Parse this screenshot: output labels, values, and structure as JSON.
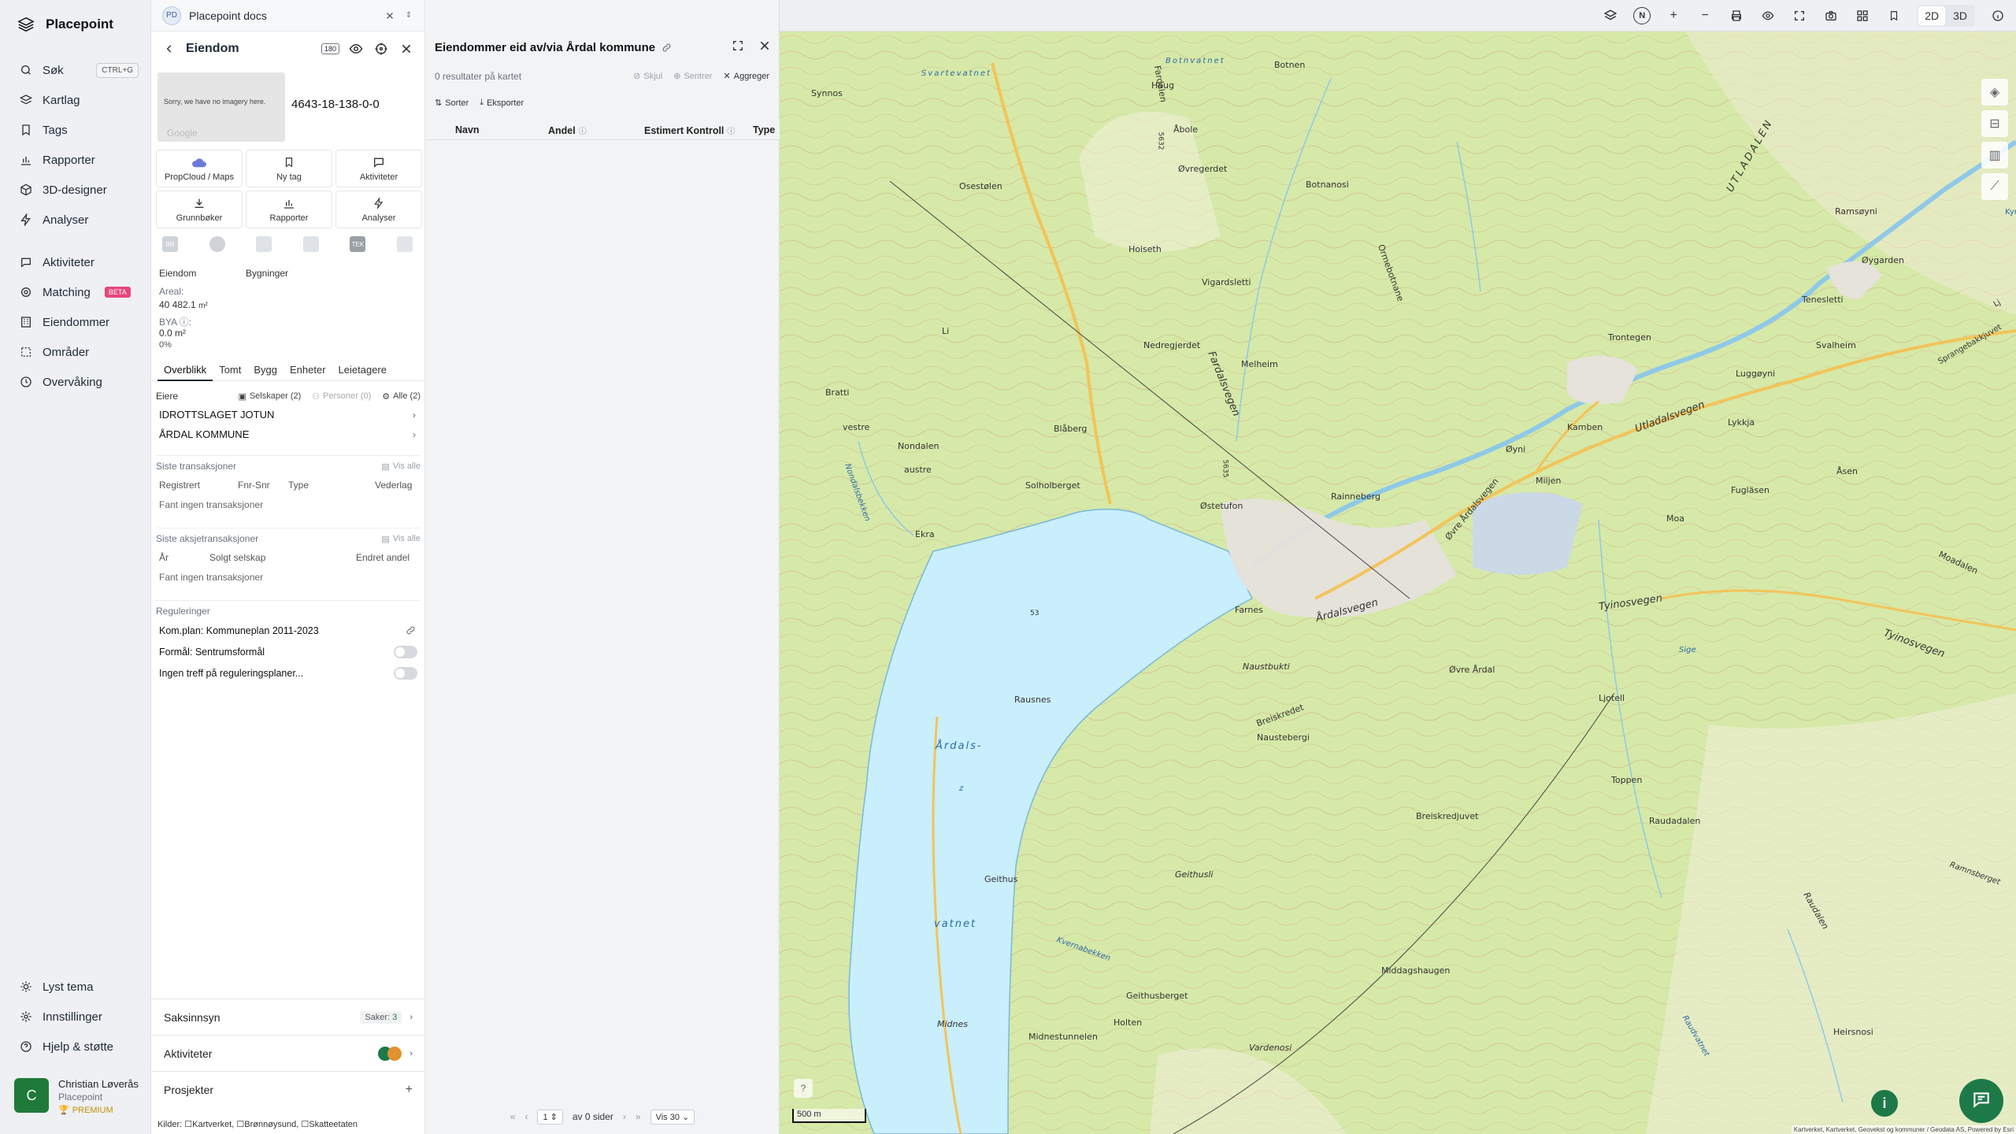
{
  "app": {
    "name": "Placepoint"
  },
  "nav": {
    "items": [
      {
        "label": "Søk",
        "shortcut": "CTRL+G"
      },
      {
        "label": "Kartlag"
      },
      {
        "label": "Tags"
      },
      {
        "label": "Rapporter"
      },
      {
        "label": "3D-designer"
      },
      {
        "label": "Analyser"
      }
    ],
    "items2": [
      {
        "label": "Aktiviteter"
      },
      {
        "label": "Matching",
        "badge": "BETA"
      },
      {
        "label": "Eiendommer"
      },
      {
        "label": "Områder"
      },
      {
        "label": "Overvåking"
      }
    ],
    "bottom": [
      {
        "label": "Lyst tema"
      },
      {
        "label": "Innstillinger"
      },
      {
        "label": "Hjelp & støtte"
      }
    ],
    "user": {
      "initial": "C",
      "name": "Christian Løverås",
      "org": "Placepoint",
      "plan": "PREMIUM"
    }
  },
  "docs": {
    "badge": "PD",
    "title": "Placepoint docs"
  },
  "property": {
    "header": "Eiendom",
    "tag_box": "180",
    "image_note": "Sorry, we have no imagery here.",
    "image_google": "Google",
    "id": "4643-18-138-0-0",
    "actions": [
      "PropCloud / Maps",
      "Ny tag",
      "Aktiviteter",
      "Grunnbøker",
      "Rapporter",
      "Analyser"
    ],
    "strip": [
      "BR",
      "",
      "",
      "",
      "TEK",
      ""
    ],
    "summary": {
      "col1_label": "Eiendom",
      "col2_label": "Bygninger",
      "areal_label": "Areal:",
      "areal_value": "40 482.1",
      "areal_unit": "m²",
      "bya_label": "BYA ⓘ:",
      "bya_value": "0.0 m²",
      "bya_pct": "0%"
    },
    "tabs": [
      "Overblikk",
      "Tomt",
      "Bygg",
      "Enheter",
      "Leietagere"
    ],
    "owners": {
      "title": "Eiere",
      "filter_companies": "Selskaper (2)",
      "filter_persons": "Personer (0)",
      "filter_all": "Alle (2)",
      "list": [
        "IDROTTSLAGET JOTUN",
        "ÅRDAL KOMMUNE"
      ]
    },
    "transactions": {
      "title": "Siste transaksjoner",
      "vis_alle": "Vis alle",
      "cols": [
        "Registrert",
        "Fnr-Snr",
        "Type",
        "Vederlag"
      ],
      "empty": "Fant ingen transaksjoner"
    },
    "share_tx": {
      "title": "Siste aksjetransaksjoner",
      "vis_alle": "Vis alle",
      "cols": [
        "År",
        "Solgt selskap",
        "Endret andel"
      ],
      "empty": "Fant ingen transaksjoner"
    },
    "regulations": {
      "title": "Reguleringer",
      "plan": "Kom.plan: Kommuneplan 2011-2023",
      "purpose": "Formål: Sentrumsformål",
      "none": "Ingen treff på reguleringsplaner..."
    },
    "bottom": {
      "saksinnsyn": "Saksinnsyn",
      "saker_label": "Saker:",
      "saker_count": "3",
      "aktiviteter": "Aktiviteter",
      "prosjekter": "Prosjekter",
      "sources_label": "Kilder:",
      "sources": [
        "Kartverket",
        "Brønnøysund",
        "Skatteetaten"
      ]
    }
  },
  "results": {
    "title": "Eiendommer eid av/via Årdal kommune",
    "count": "0 resultater på kartet",
    "skjul": "Skjul",
    "sentrer": "Sentrer",
    "aggreger": "Aggreger",
    "sorter": "Sorter",
    "eksporter": "Eksporter",
    "columns": [
      "Navn",
      "Andel",
      "Estimert Kontroll",
      "Type"
    ],
    "pager": {
      "page": "1",
      "of": "av 0 sider",
      "per": "Vis 30"
    }
  },
  "map": {
    "mode_2d": "2D",
    "mode_3d": "3D",
    "north": "N",
    "scale": "500 m",
    "attribution": "Kartverket, Kartverket, Geovekst og kommuner / Geodata AS, Powered by Esri",
    "labels": {
      "synnos": "Synnos",
      "svartevatnet": "Svartevatnet",
      "botnvatnet": "Botnvatnet",
      "botnen": "Botnen",
      "farladen": "Fardalen",
      "haug": "Haug",
      "abole": "Åbole",
      "osestolen": "Osestølen",
      "oveggerdet": "Øvregerdet",
      "botnanosi": "Botnanosi",
      "hoiseth": "Hoiseth",
      "vigardsletti": "Vigardsletti",
      "nedregjerdet": "Nedregjerdet",
      "melheim": "Melheim",
      "fardalsvegen": "Fardalsvegen",
      "ormebotnane": "Ormebotnane",
      "utladalen": "UTLADALEN",
      "ramsoyni": "Ramsøyni",
      "oygarden": "Øygarden",
      "tenesletti": "Tenesletti",
      "svalheim": "Svalheim",
      "trontegen": "Trontegen",
      "luggoyni": "Luggøyni",
      "utladalsvegen": "Utladalsvegen",
      "kamben": "Kamben",
      "lykkja": "Lykkja",
      "oyni": "Øyni",
      "fuglaasen": "Fugläsen",
      "asen": "Åsen",
      "moa": "Moa",
      "moadalen": "Moadalen",
      "blaberg": "Blåberg",
      "nondalen": "Nondalen",
      "austre": "austre",
      "solholberget": "Solholberget",
      "bratti": "Bratti",
      "vestre": "vestre",
      "miljen": "Miljen",
      "rainneberg": "Rainneberg",
      "ostetufon": "Østetufon",
      "ekra": "Ekra",
      "farnes": "Farnes",
      "ardalsvegen": "Årdalsvegen",
      "tyinosvegen": "Tyinosvegen",
      "tyinosvegen2": "Tyinosvegen",
      "naustebukti": "Naustbukti",
      "ovreardal": "Øvre Årdal",
      "rausnes": "Rausnes",
      "ardalsvatnet1": "Årdals-",
      "ardalsvatnet2": "vatnet",
      "z": "z",
      "nausteberg": "Naustebergi",
      "breiskredet": "Breiskredet",
      "ljotell": "Ljotell",
      "toppen": "Toppen",
      "breiskredjuvet": "Breiskredjuvet",
      "raudadalen": "Raudadalen",
      "geithus": "Geithus",
      "geithusli": "Geithusli",
      "krommbekken": "Kvernabekken",
      "middagshaugen": "Middagshaugen",
      "geithusberget": "Geithusberget",
      "holten": "Holten",
      "midnes": "Midnes",
      "midnestunnelen": "Midnestunnelen",
      "heirsnosi": "Heirsnosi",
      "vardenosi": "Vardenosi",
      "raudelen": "Raudalen",
      "spranget": "Sprangebakkjuvet",
      "rauvatn": "Raudvatnet",
      "sige": "Sige",
      "ovreardalsvegen": "Øvre Årdalsvegen",
      "kyn": "Kyn",
      "lj": "Lj",
      "li": "Li",
      "nondalsbekken": "Nondalsbekken",
      "rundbakkjuvet": "Ramnsberget",
      "n53": "53",
      "n5632": "5632",
      "n5635": "5635"
    }
  },
  "colors": {
    "brand_green": "#1d7a48",
    "beta": "#e8457a",
    "water": "#c9eefc",
    "forest": "#dcebb5"
  }
}
